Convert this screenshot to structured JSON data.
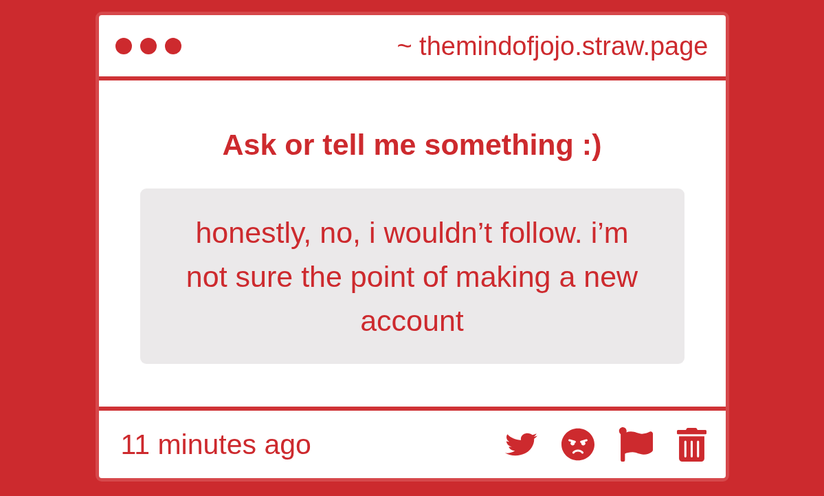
{
  "window": {
    "address": "~ themindofjojo.straw.page"
  },
  "prompt": "Ask or tell me something :)",
  "message": "honestly, no, i wouldn’t follow. i’m not sure the point of making a new account",
  "footer": {
    "time": "11 minutes ago",
    "actions": [
      {
        "kind": "share"
      },
      {
        "kind": "react"
      },
      {
        "kind": "report"
      },
      {
        "kind": "delete"
      }
    ]
  }
}
